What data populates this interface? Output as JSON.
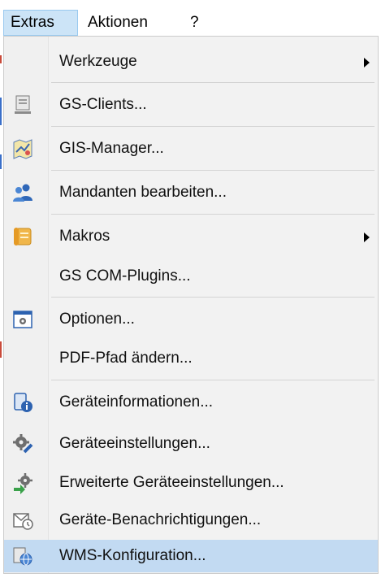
{
  "menubar": {
    "items": [
      {
        "label": "Extras"
      },
      {
        "label": "Aktionen"
      },
      {
        "label": "?"
      }
    ]
  },
  "menu": {
    "items": [
      {
        "label": "Werkzeuge",
        "icon": "none",
        "submenu": true
      },
      {
        "label": "GS-Clients...",
        "icon": "computer-icon"
      },
      {
        "label": "GIS-Manager...",
        "icon": "map-icon"
      },
      {
        "label": "Mandanten bearbeiten...",
        "icon": "users-icon"
      },
      {
        "label": "Makros",
        "icon": "scroll-icon",
        "submenu": true
      },
      {
        "label": "GS COM-Plugins...",
        "icon": "none"
      },
      {
        "label": "Optionen...",
        "icon": "settings-window-icon"
      },
      {
        "label": "PDF-Pfad ändern...",
        "icon": "none"
      },
      {
        "label": "Geräteinformationen...",
        "icon": "device-info-icon"
      },
      {
        "label": "Geräteeinstellungen...",
        "icon": "gear-pencil-icon"
      },
      {
        "label": "Erweiterte Geräteeinstellungen...",
        "icon": "gear-arrow-icon"
      },
      {
        "label": "Geräte-Benachrichtigungen...",
        "icon": "notification-icon"
      },
      {
        "label": "WMS-Konfiguration...",
        "icon": "wms-globe-icon",
        "highlighted": true
      }
    ]
  },
  "colors": {
    "menubar_active_bg": "#cce4f7",
    "menu_bg": "#f2f2f2",
    "highlight_bg": "#c2daf2"
  }
}
